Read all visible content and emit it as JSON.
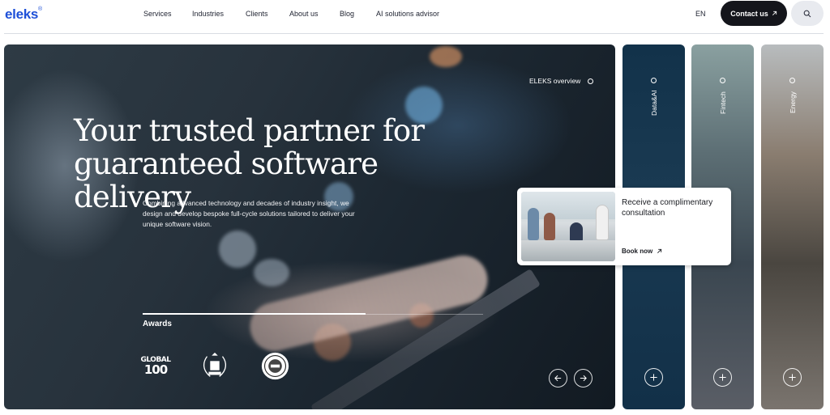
{
  "brand": {
    "logo_text": "eleks",
    "logo_mark": "®",
    "accent": "#1e50d8"
  },
  "nav": {
    "items": [
      {
        "label": "Services"
      },
      {
        "label": "Industries"
      },
      {
        "label": "Clients"
      },
      {
        "label": "About us"
      },
      {
        "label": "Blog"
      },
      {
        "label": "AI solutions advisor"
      }
    ],
    "language": "EN",
    "contact_label": "Contact us",
    "contact_icon": "arrow-up-right-icon",
    "search_icon": "search-icon"
  },
  "hero": {
    "headline": "Your trusted partner for guaranteed software delivery",
    "subtext": "Combining advanced technology and decades of industry insight, we design and develop bespoke full-cycle solutions tailored to deliver your unique software vision.",
    "overview_label": "ELEKS overview",
    "awards_title": "Awards",
    "awards": [
      {
        "name": "global-100-award",
        "text_top": "GLOBAL",
        "text_bottom": "100"
      },
      {
        "name": "laurel-award"
      },
      {
        "name": "seal-award"
      }
    ],
    "prev_icon": "arrow-left-icon",
    "next_icon": "arrow-right-icon"
  },
  "consultation_card": {
    "title": "Receive a complimentary consultation",
    "link_label": "Book now",
    "link_icon": "arrow-up-right-icon"
  },
  "side_panels": [
    {
      "label": "Data&AI",
      "icon": "plus-icon"
    },
    {
      "label": "Fintech",
      "icon": "plus-icon"
    },
    {
      "label": "Energy",
      "icon": "plus-icon"
    }
  ]
}
